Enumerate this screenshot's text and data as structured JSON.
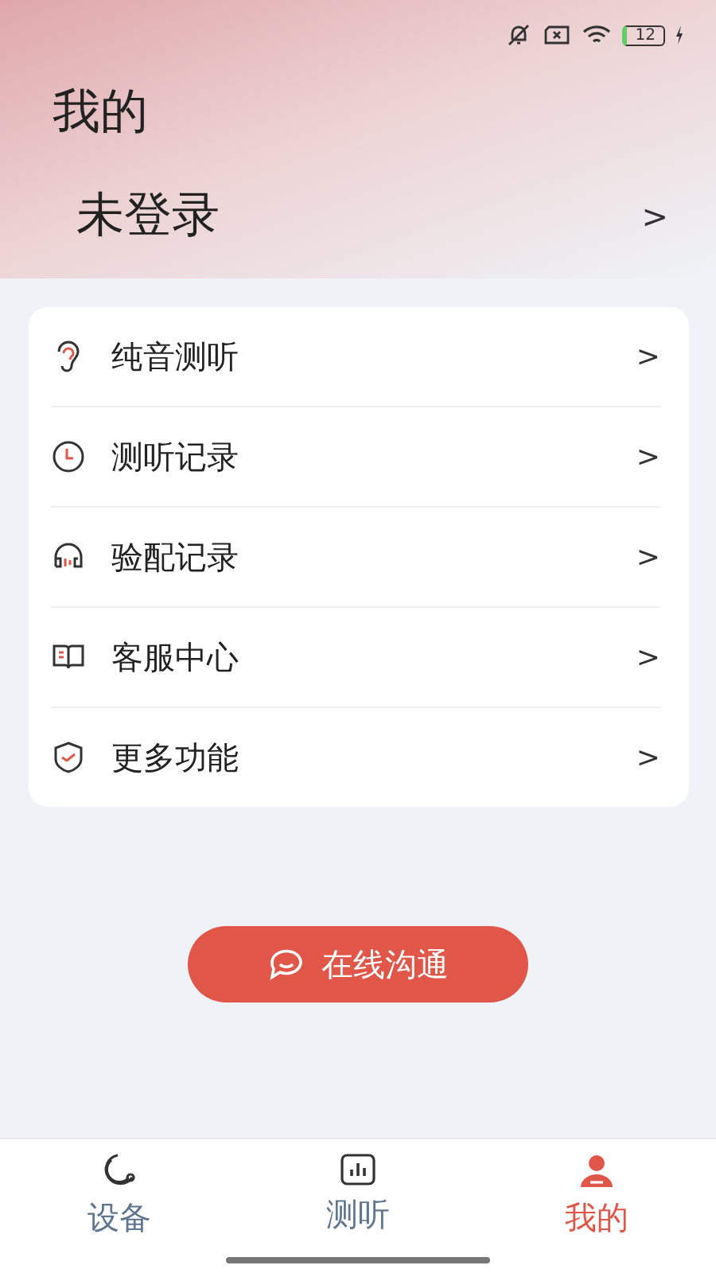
{
  "status_bar": {
    "battery": "12"
  },
  "header": {
    "title": "我的",
    "login": "未登录",
    "chevron": ">"
  },
  "menu": [
    {
      "kind": "ear",
      "label": "纯音测听",
      "chevron": ">"
    },
    {
      "kind": "clock",
      "label": "测听记录",
      "chevron": ">"
    },
    {
      "kind": "headphones",
      "label": "验配记录",
      "chevron": ">"
    },
    {
      "kind": "book",
      "label": "客服中心",
      "chevron": ">"
    },
    {
      "kind": "shield",
      "label": "更多功能",
      "chevron": ">"
    }
  ],
  "chat_button": {
    "label": "在线沟通"
  },
  "tabs": [
    {
      "kind": "device",
      "label": "设备",
      "selected": false
    },
    {
      "kind": "test",
      "label": "测听",
      "selected": false
    },
    {
      "kind": "me",
      "label": "我的",
      "selected": true
    }
  ]
}
